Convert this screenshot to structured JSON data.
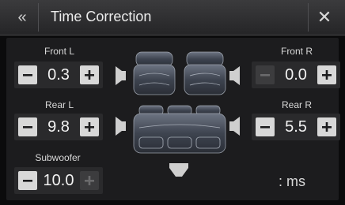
{
  "header": {
    "back_icon": "double-chevron-left-icon",
    "title": "Time Correction",
    "close_label": "✕"
  },
  "channels": {
    "front_l": {
      "label": "Front L",
      "value": "0.3"
    },
    "front_r": {
      "label": "Front R",
      "value": "0.0"
    },
    "rear_l": {
      "label": "Rear L",
      "value": "9.8"
    },
    "rear_r": {
      "label": "Rear R",
      "value": "5.5"
    },
    "subwoofer": {
      "label": "Subwoofer",
      "value": "10.0"
    }
  },
  "unit": ": ms",
  "icons": {
    "minus": "minus-icon",
    "plus": "plus-icon",
    "speaker": "speaker-icon",
    "seat": "car-seat-icon",
    "subwoofer": "subwoofer-icon"
  },
  "colors": {
    "header_bg": "#2f2f31",
    "panel_bg": "#1c1c1e",
    "button_active": "#d8d8d8",
    "button_disabled": "#3c3c3e"
  }
}
